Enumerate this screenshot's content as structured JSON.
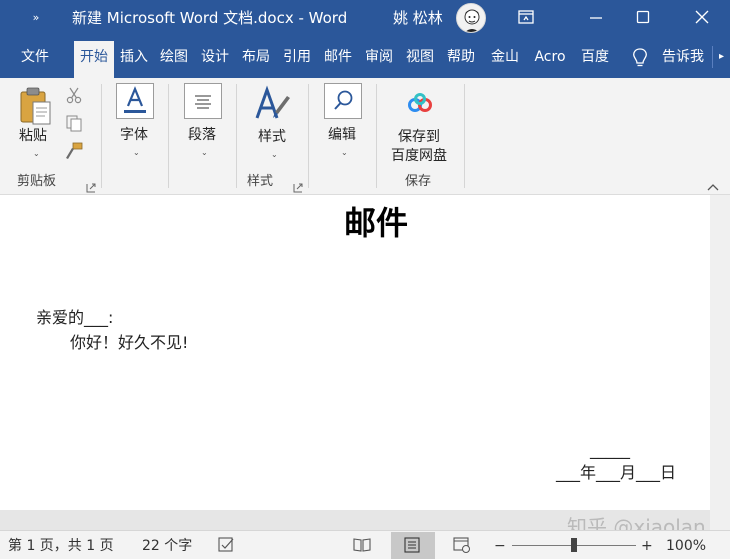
{
  "titlebar": {
    "qat_glyph": "»",
    "doc_title": "新建 Microsoft Word 文档.docx  -  Word",
    "user_name": "姚 松林"
  },
  "tabs": [
    "文件",
    "开始",
    "插入",
    "绘图",
    "设计",
    "布局",
    "引用",
    "邮件",
    "审阅",
    "视图",
    "帮助",
    "金山",
    "Acro",
    "百度",
    "告诉我"
  ],
  "active_tab": "开始",
  "ribbon": {
    "paste_label": "粘贴",
    "clipboard_group": "剪贴板",
    "font_label": "字体",
    "paragraph_label": "段落",
    "styles_label": "样式",
    "styles_group": "样式",
    "editing_label": "编辑",
    "save_line1": "保存到",
    "save_line2": "百度网盘",
    "save_group": "保存"
  },
  "document": {
    "heading": "邮件",
    "greeting": "亲爱的___:",
    "body": "你好！好久不见!",
    "signature_line": "_____",
    "date_line": "___年___月___日"
  },
  "status": {
    "page_info": "第 1 页，共 1 页",
    "word_count": "22 个字",
    "zoom_minus": "−",
    "zoom_plus": "+",
    "zoom_percent": "100%",
    "zoom_value": 100
  },
  "watermark": "知乎 @xiaolan",
  "colors": {
    "titlebar": "#2b579a",
    "ribbon": "#f3f3f3",
    "statusbar": "#f3f3f3"
  },
  "icons": [
    "more-icon",
    "restore-icon",
    "minimize-icon",
    "maximize-icon",
    "close-icon",
    "lightbulb-icon",
    "cut-icon",
    "copy-icon",
    "format-painter-icon",
    "font-icon",
    "paragraph-icon",
    "styles-icon",
    "search-icon",
    "baidu-cloud-icon",
    "proofing-icon",
    "read-mode-icon",
    "print-layout-icon",
    "web-layout-icon"
  ]
}
